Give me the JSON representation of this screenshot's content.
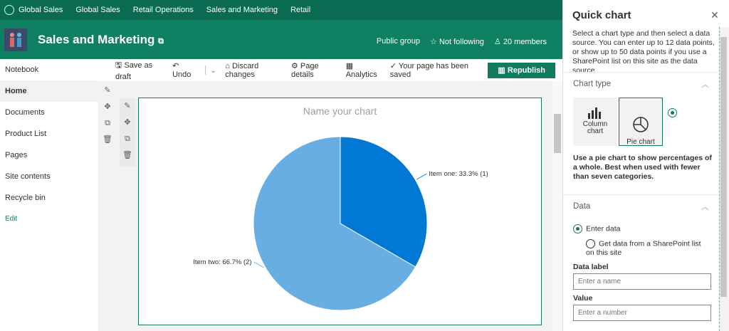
{
  "topbar": {
    "items": [
      "Global Sales",
      "Global Sales",
      "Retail Operations",
      "Sales and Marketing",
      "Retail"
    ]
  },
  "header": {
    "title": "Sales and Marketing",
    "public_group": "Public group",
    "follow": "Not following",
    "members": "20 members"
  },
  "nav": {
    "items": [
      "Notebook",
      "Home",
      "Documents",
      "Product List",
      "Pages",
      "Site contents",
      "Recycle bin"
    ],
    "edit": "Edit"
  },
  "toolbar": {
    "save_draft": "Save as draft",
    "undo": "Undo",
    "discard": "Discard changes",
    "page_details": "Page details",
    "analytics": "Analytics",
    "saved": "Your page has been saved",
    "republish": "Republish"
  },
  "colors": {
    "brand": "#0f7b5f",
    "slice1": "#0078d4",
    "slice2": "#69aee3"
  },
  "chart_data": {
    "type": "pie",
    "title": "Name your chart",
    "slices": [
      {
        "label": "Item one",
        "value": 1,
        "percent": 33.3,
        "text": "Item one: 33.3% (1)"
      },
      {
        "label": "Item two",
        "value": 2,
        "percent": 66.7,
        "text": "Item two: 66.7% (2)"
      }
    ]
  },
  "panel": {
    "title": "Quick chart",
    "description": "Select a chart type and then select a data source. You can enter up to 12 data points, or show up to 50 data points if you use a SharePoint list on this site as the data source.",
    "chart_type_heading": "Chart type",
    "column_chart": "Column chart",
    "pie_chart": "Pie chart",
    "pie_desc": "Use a pie chart to show percentages of a whole. Best when used with fewer than seven categories.",
    "data_heading": "Data",
    "enter_data": "Enter data",
    "sp_list": "Get data from a SharePoint list on this site",
    "data_label": "Data label",
    "data_label_placeholder": "Enter a name",
    "value": "Value",
    "value_placeholder": "Enter a number"
  }
}
